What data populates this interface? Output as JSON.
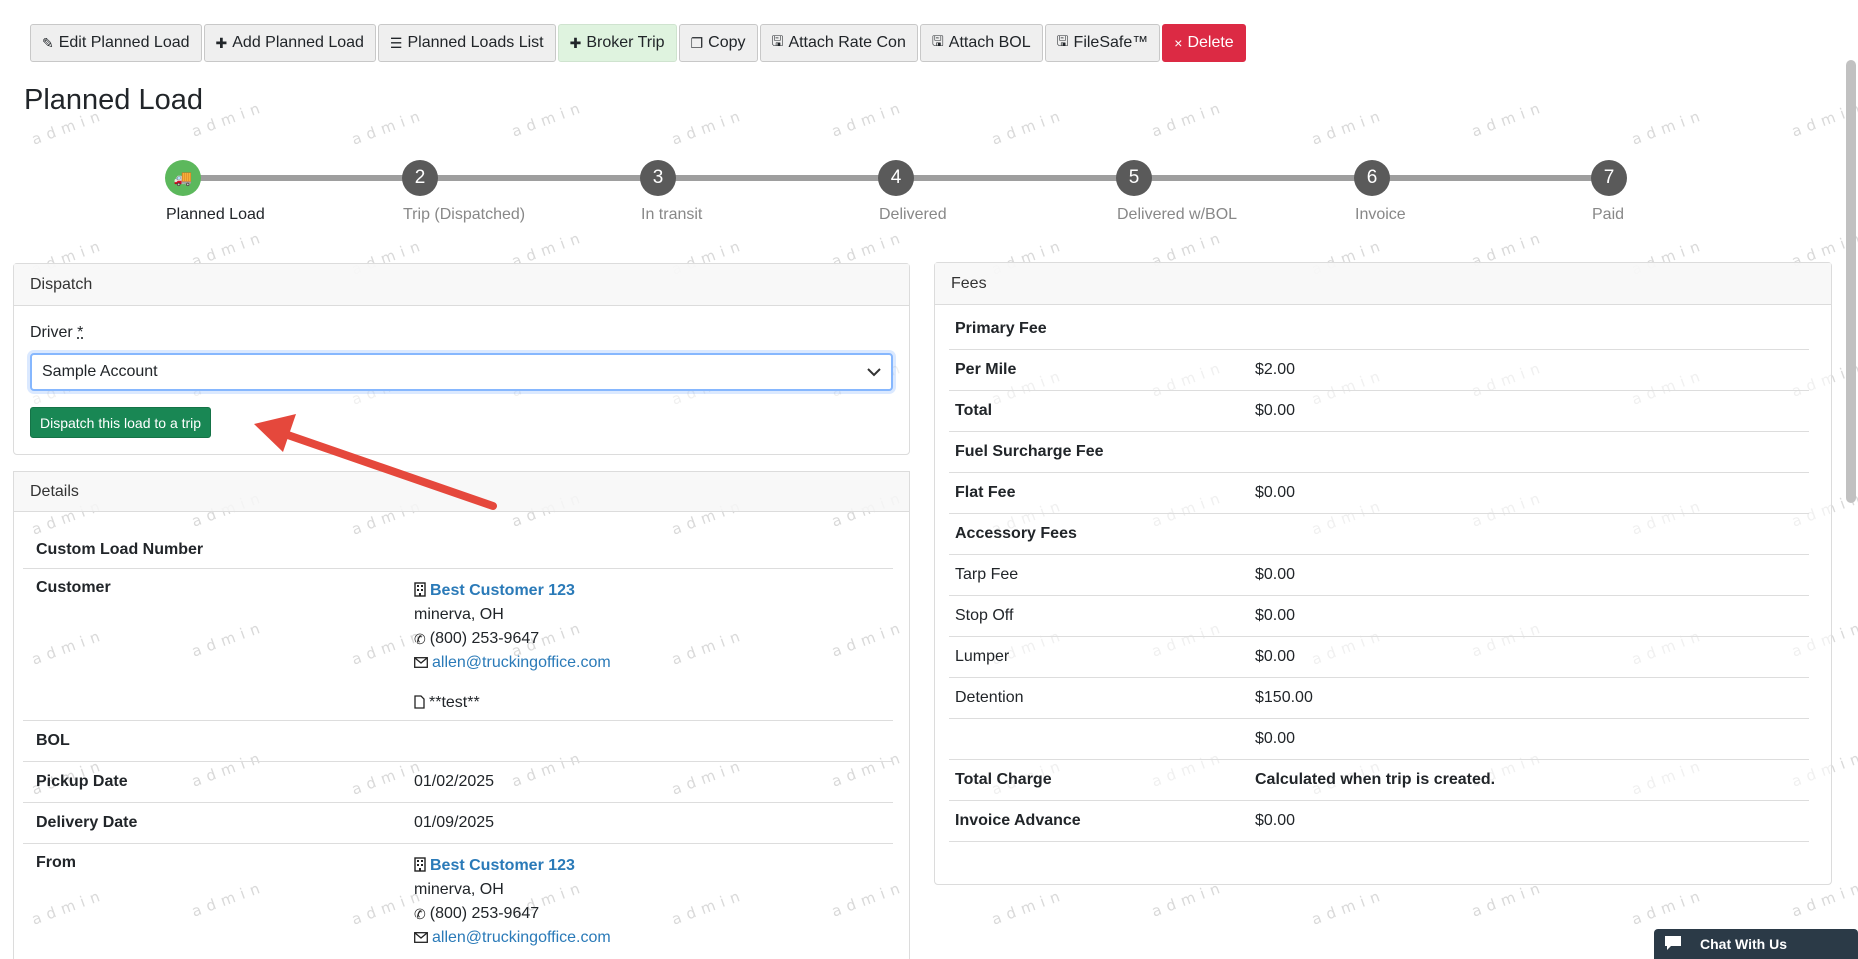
{
  "toolbar": {
    "buttons": [
      {
        "label": "Edit Planned Load",
        "icon": "pencil-icon",
        "glyph": "✎"
      },
      {
        "label": "Add Planned Load",
        "icon": "plus-icon",
        "glyph": "✚"
      },
      {
        "label": "Planned Loads List",
        "icon": "list-icon",
        "glyph": "☰"
      },
      {
        "label": "Broker Trip",
        "icon": "plus-icon",
        "glyph": "✚"
      },
      {
        "label": "Copy",
        "icon": "copy-icon",
        "glyph": "❐"
      },
      {
        "label": "Attach Rate Con",
        "icon": "save-icon",
        "glyph": "🖫"
      },
      {
        "label": "Attach BOL",
        "icon": "save-icon",
        "glyph": "🖫"
      },
      {
        "label": "FileSafe™",
        "icon": "save-icon",
        "glyph": "🖫"
      },
      {
        "label": "Delete",
        "icon": "close-icon",
        "glyph": "×"
      }
    ]
  },
  "page_title": "Planned Load",
  "watermark": "admin",
  "stepper": {
    "steps": [
      {
        "num": "",
        "label": "Planned Load",
        "icon": "truck-icon",
        "glyph": "🚚"
      },
      {
        "num": "2",
        "label": "Trip (Dispatched)"
      },
      {
        "num": "3",
        "label": "In transit"
      },
      {
        "num": "4",
        "label": "Delivered"
      },
      {
        "num": "5",
        "label": "Delivered w/BOL"
      },
      {
        "num": "6",
        "label": "Invoice"
      },
      {
        "num": "7",
        "label": "Paid"
      }
    ]
  },
  "dispatch": {
    "title": "Dispatch",
    "driver_label": "Driver",
    "required_mark": "*",
    "driver_value": "Sample Account",
    "dispatch_button": "Dispatch this load to a trip"
  },
  "details": {
    "title": "Details",
    "custom_load_number_label": "Custom Load Number",
    "customer_label": "Customer",
    "customer": {
      "name": "Best Customer 123",
      "city": "minerva, OH",
      "phone": "(800) 253-9647",
      "email": "allen@truckingoffice.com",
      "note": "**test**"
    },
    "bol_label": "BOL",
    "pickup_label": "Pickup Date",
    "pickup_date": "01/02/2025",
    "delivery_label": "Delivery Date",
    "delivery_date": "01/09/2025",
    "from_label": "From",
    "from": {
      "name": "Best Customer 123",
      "city": "minerva, OH",
      "phone": "(800) 253-9647",
      "email": "allen@truckingoffice.com"
    }
  },
  "fees": {
    "title": "Fees",
    "rows": [
      {
        "label": "Primary Fee",
        "value": "",
        "bold": true
      },
      {
        "label": "Per Mile",
        "value": "$2.00",
        "bold": true
      },
      {
        "label": "Total",
        "value": "$0.00",
        "bold": true
      },
      {
        "label": "Fuel Surcharge Fee",
        "value": "",
        "bold": true
      },
      {
        "label": "Flat Fee",
        "value": "$0.00",
        "bold": true
      },
      {
        "label": "Accessory Fees",
        "value": "",
        "bold": true
      },
      {
        "label": "Tarp Fee",
        "value": "$0.00",
        "bold": false
      },
      {
        "label": "Stop Off",
        "value": "$0.00",
        "bold": false
      },
      {
        "label": "Lumper",
        "value": "$0.00",
        "bold": false
      },
      {
        "label": "Detention",
        "value": "$150.00",
        "bold": false
      },
      {
        "label": "",
        "value": "$0.00",
        "bold": false
      },
      {
        "label": "Total Charge",
        "value": "Calculated when trip is created.",
        "bold": true,
        "value_bold": true
      },
      {
        "label": "Invoice Advance",
        "value": "$0.00",
        "bold": true
      }
    ]
  },
  "chat": {
    "label": "Chat With Us",
    "icon": "chat-icon"
  },
  "colors": {
    "accent_green": "#198754",
    "danger": "#dc2a44",
    "step_active": "#5cb85c",
    "link": "#2a7ab8"
  }
}
